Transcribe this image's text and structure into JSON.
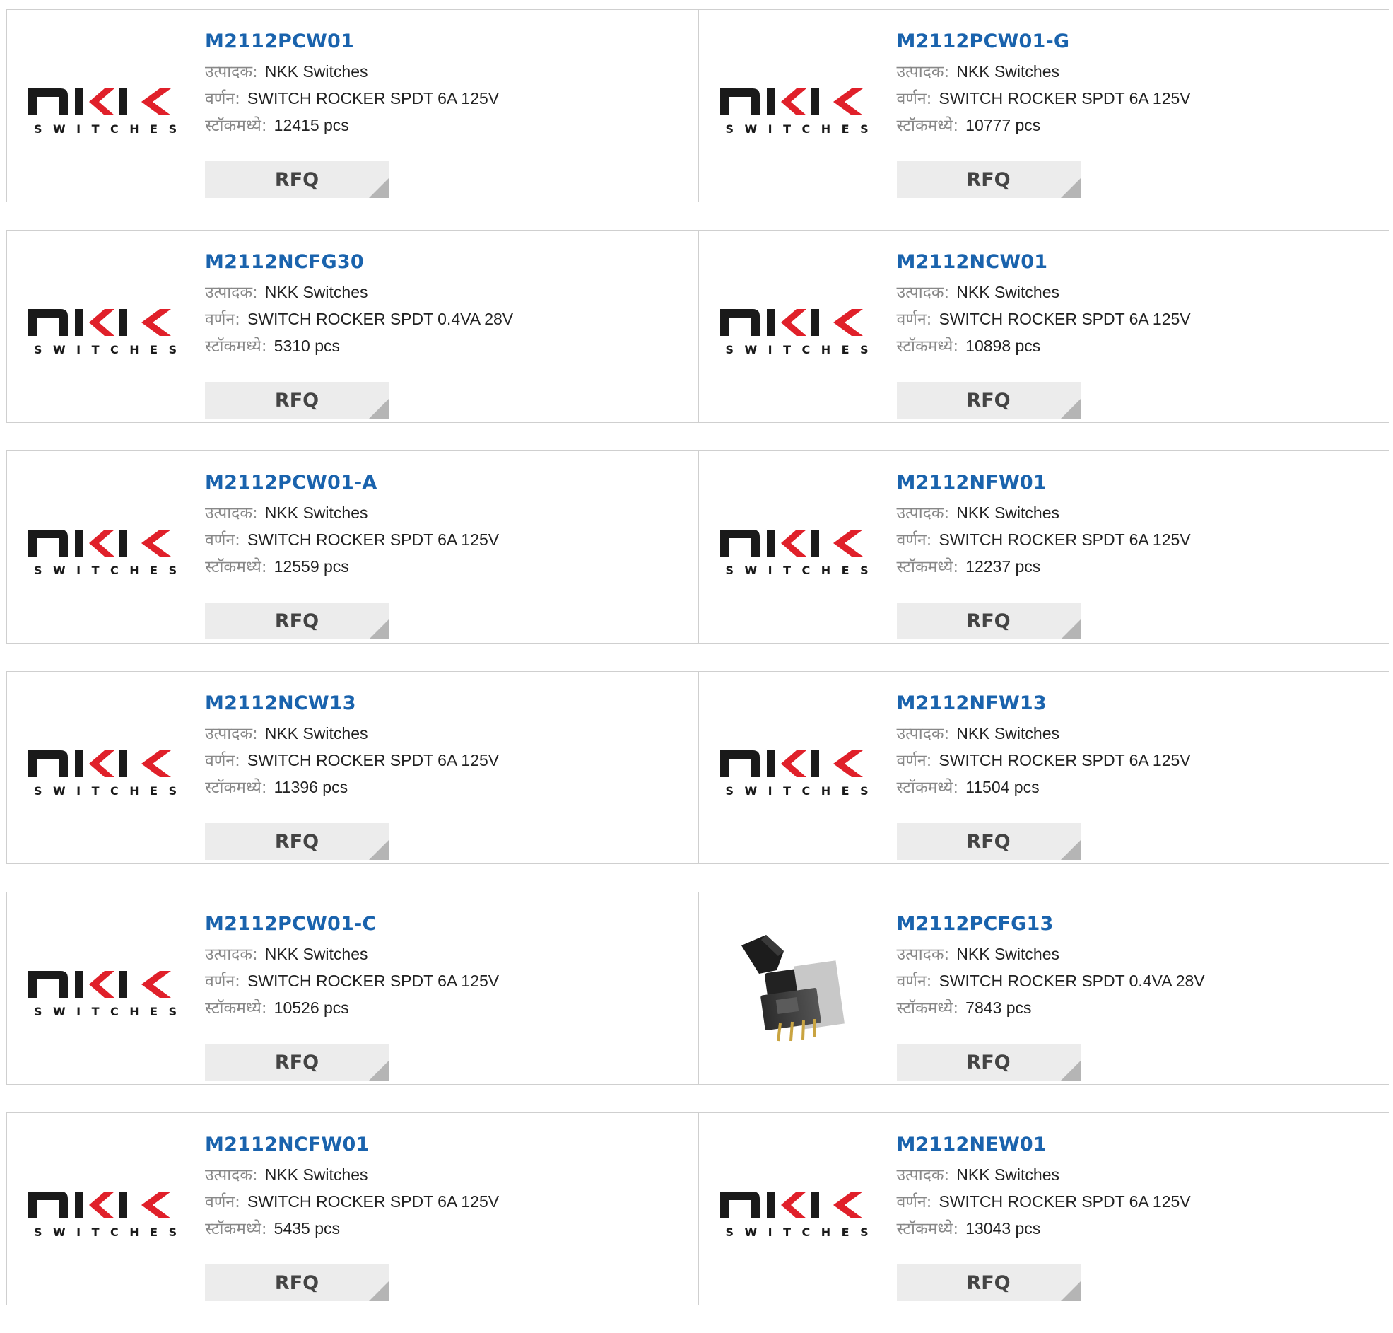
{
  "labels": {
    "manufacturer": "उत्पादक:",
    "description": "वर्णन:",
    "in_stock": "स्टॉकमध्ये:",
    "rfq": "RFQ"
  },
  "logo_text": "SWITCHES",
  "products": [
    {
      "part": "M2112PCW01",
      "manufacturer": "NKK Switches",
      "description": "SWITCH ROCKER SPDT 6A 125V",
      "stock": "12415 pcs",
      "image": "nkk-logo"
    },
    {
      "part": "M2112PCW01-G",
      "manufacturer": "NKK Switches",
      "description": "SWITCH ROCKER SPDT 6A 125V",
      "stock": "10777 pcs",
      "image": "nkk-logo"
    },
    {
      "part": "M2112NCFG30",
      "manufacturer": "NKK Switches",
      "description": "SWITCH ROCKER SPDT 0.4VA 28V",
      "stock": "5310 pcs",
      "image": "nkk-logo"
    },
    {
      "part": "M2112NCW01",
      "manufacturer": "NKK Switches",
      "description": "SWITCH ROCKER SPDT 6A 125V",
      "stock": "10898 pcs",
      "image": "nkk-logo"
    },
    {
      "part": "M2112PCW01-A",
      "manufacturer": "NKK Switches",
      "description": "SWITCH ROCKER SPDT 6A 125V",
      "stock": "12559 pcs",
      "image": "nkk-logo"
    },
    {
      "part": "M2112NFW01",
      "manufacturer": "NKK Switches",
      "description": "SWITCH ROCKER SPDT 6A 125V",
      "stock": "12237 pcs",
      "image": "nkk-logo"
    },
    {
      "part": "M2112NCW13",
      "manufacturer": "NKK Switches",
      "description": "SWITCH ROCKER SPDT 6A 125V",
      "stock": "11396 pcs",
      "image": "nkk-logo"
    },
    {
      "part": "M2112NFW13",
      "manufacturer": "NKK Switches",
      "description": "SWITCH ROCKER SPDT 6A 125V",
      "stock": "11504 pcs",
      "image": "nkk-logo"
    },
    {
      "part": "M2112PCW01-C",
      "manufacturer": "NKK Switches",
      "description": "SWITCH ROCKER SPDT 6A 125V",
      "stock": "10526 pcs",
      "image": "nkk-logo"
    },
    {
      "part": "M2112PCFG13",
      "manufacturer": "NKK Switches",
      "description": "SWITCH ROCKER SPDT 0.4VA 28V",
      "stock": "7843 pcs",
      "image": "rocker-switch-photo"
    },
    {
      "part": "M2112NCFW01",
      "manufacturer": "NKK Switches",
      "description": "SWITCH ROCKER SPDT 6A 125V",
      "stock": "5435 pcs",
      "image": "nkk-logo"
    },
    {
      "part": "M2112NEW01",
      "manufacturer": "NKK Switches",
      "description": "SWITCH ROCKER SPDT 6A 125V",
      "stock": "13043 pcs",
      "image": "nkk-logo"
    }
  ],
  "colors": {
    "part_link": "#1a63ad",
    "logo_dark": "#1a1a1a",
    "logo_red": "#e0202a",
    "rfq_bg": "#ececec",
    "border": "#cfcfcf"
  }
}
